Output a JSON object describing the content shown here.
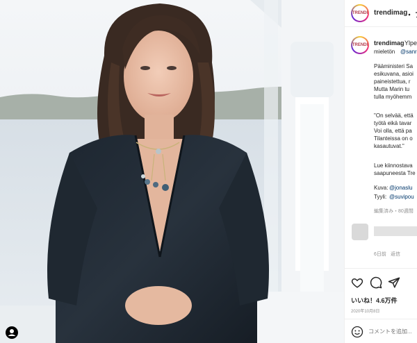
{
  "header": {
    "avatar_text": "TRENDI",
    "username": "trendimag",
    "follow_fragment": "・ フ"
  },
  "caption": {
    "avatar_text": "TRENDI",
    "username": "trendimag",
    "first_text": "Ylpe",
    "line2_prefix": "mieletön",
    "mention": "@sanr",
    "lines": [
      "Pääministeri Sa",
      "esikuvana, asioi",
      "paineistettua, r",
      "Mutta Marin tu",
      "tulla myöhemm"
    ],
    "quote_lines": [
      "\"On selvää, että",
      "työtä eikä tavar",
      "Voi olla, että pa",
      "Tilanteissa on o",
      "kasautuvat.\""
    ],
    "more_lines": [
      "Lue kiinnostava",
      "saapuneesta Tre"
    ],
    "credit1_label": "Kuva:",
    "credit1_link": "@jonaslu",
    "credit2_label": "Tyyli:",
    "credit2_link": "@suvipou",
    "edited": "編集済み・80週間"
  },
  "comment": {
    "time": "6日前",
    "reply": "返信"
  },
  "actions": {
    "like": "heart-icon",
    "comment": "comment-icon",
    "share": "send-icon"
  },
  "likes": "いいね！4.6万件",
  "date": "2020年10月8日",
  "add_comment": {
    "placeholder": "コメントを追加...",
    "emoji": "smile-icon"
  }
}
